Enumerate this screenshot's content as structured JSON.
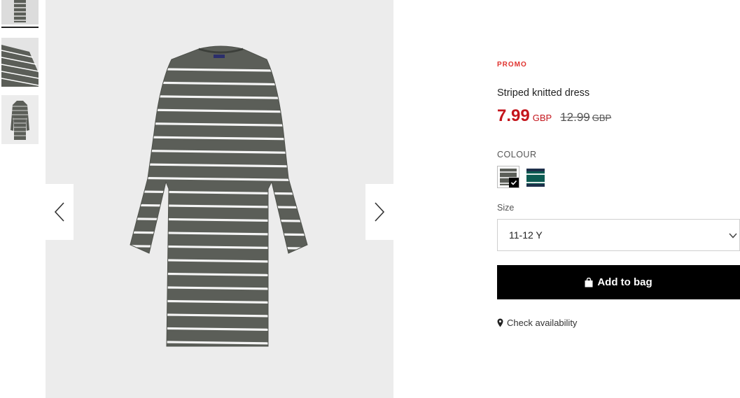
{
  "product": {
    "promo_label": "PROMO",
    "title": "Striped knitted dress",
    "price_now": "7.99",
    "currency_now": "GBP",
    "price_old": "12.99",
    "currency_old": "GBP",
    "colour_label": "COLOUR",
    "colours": [
      {
        "name": "grey-white-stripe",
        "selected": true,
        "base": "#5b5e58",
        "stripe": "#ffffff"
      },
      {
        "name": "green-navy-stripe",
        "selected": false,
        "base": "#0d5b52",
        "stripe": "#ffffff"
      }
    ],
    "size_label": "Size",
    "size_value": "11-12 Y",
    "add_to_bag_label": "Add to bag",
    "check_availability_label": "Check availability"
  },
  "gallery": {
    "thumbnail_count": 3,
    "active_thumbnail": 1
  },
  "colors": {
    "promo": "#e0322e",
    "sale_price": "#c4151c",
    "button_bg": "#000000",
    "image_bg": "#ececec",
    "dress_base": "#5b5e58",
    "dress_stripe": "#ffffff"
  }
}
